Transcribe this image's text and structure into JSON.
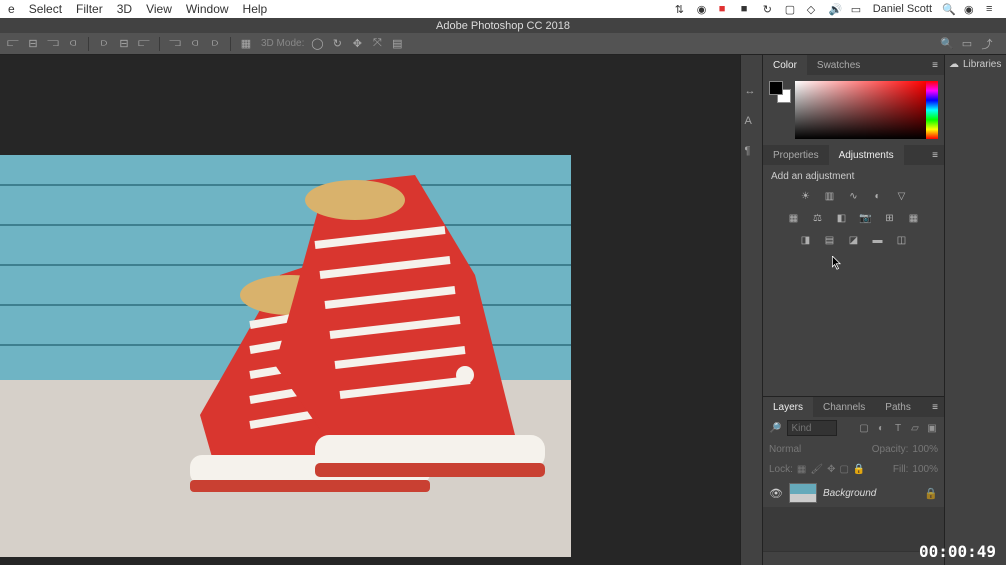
{
  "mac_menu": {
    "items": [
      "e",
      "Select",
      "Filter",
      "3D",
      "View",
      "Window",
      "Help"
    ],
    "user": "Daniel Scott"
  },
  "titlebar": {
    "title": "Adobe Photoshop CC 2018"
  },
  "optionsbar": {
    "mode_label": "3D Mode:"
  },
  "panels": {
    "color": {
      "tabs": [
        "Color",
        "Swatches"
      ],
      "active": 0
    },
    "adjustments": {
      "tabs": [
        "Properties",
        "Adjustments"
      ],
      "active": 1,
      "label": "Add an adjustment"
    },
    "layers": {
      "tabs": [
        "Layers",
        "Channels",
        "Paths"
      ],
      "active": 0,
      "filter_placeholder": "Kind",
      "blend_mode": "Normal",
      "opacity_label": "Opacity:",
      "opacity_value": "100%",
      "lock_label": "Lock:",
      "fill_label": "Fill:",
      "fill_value": "100%",
      "rows": [
        {
          "name": "Background"
        }
      ]
    },
    "libraries": {
      "label": "Libraries"
    }
  },
  "timestamp": "00:00:49"
}
